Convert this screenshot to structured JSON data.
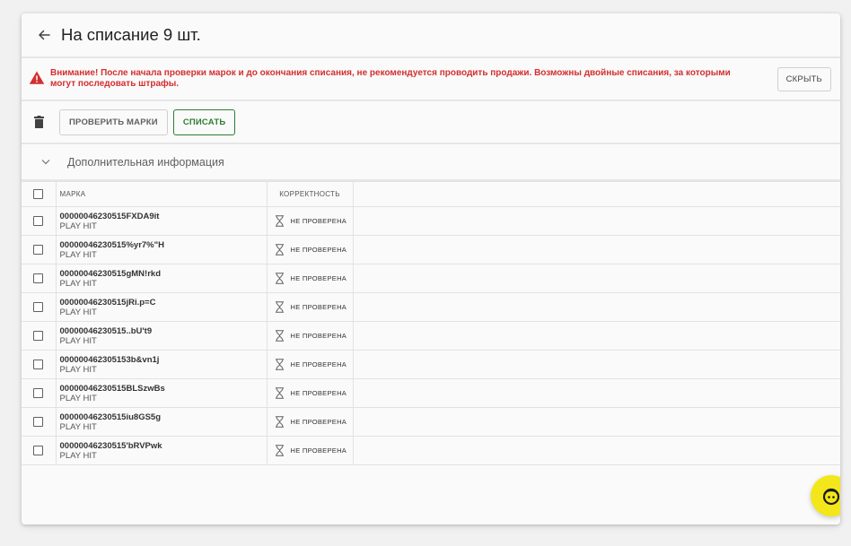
{
  "header": {
    "title": "На списание 9 шт."
  },
  "alert": {
    "text": "Внимание! После начала проверки марок и до окончания списания, не рекомендуется проводить продажи. Возможны двойные списания, за которыми могут последовать штрафы.",
    "hide_label": "СКРЫТЬ",
    "color": "#d32f2f"
  },
  "toolbar": {
    "check_label": "ПРОВЕРИТЬ МАРКИ",
    "write_off_label": "СПИСАТЬ",
    "write_off_color": "#2e7d32"
  },
  "more_info": {
    "label": "Дополнительная информация"
  },
  "table": {
    "columns": [
      "МАРКА",
      "КОРРЕКТНОСТЬ"
    ],
    "rows": [
      {
        "code": "00000046230515FXDA9it",
        "product": "PLAY HIT",
        "status": "НЕ ПРОВЕРЕНА"
      },
      {
        "code": "00000046230515%yr7%\"H",
        "product": "PLAY HIT",
        "status": "НЕ ПРОВЕРЕНА"
      },
      {
        "code": "00000046230515gMN!rkd",
        "product": "PLAY HIT",
        "status": "НЕ ПРОВЕРЕНА"
      },
      {
        "code": "00000046230515jRi.p=C",
        "product": "PLAY HIT",
        "status": "НЕ ПРОВЕРЕНА"
      },
      {
        "code": "00000046230515..bU't9",
        "product": "PLAY HIT",
        "status": "НЕ ПРОВЕРЕНА"
      },
      {
        "code": "000000462305153b&vn1j",
        "product": "PLAY HIT",
        "status": "НЕ ПРОВЕРЕНА"
      },
      {
        "code": "00000046230515BLSzwBs",
        "product": "PLAY HIT",
        "status": "НЕ ПРОВЕРЕНА"
      },
      {
        "code": "00000046230515iu8GS5g",
        "product": "PLAY HIT",
        "status": "НЕ ПРОВЕРЕНА"
      },
      {
        "code": "00000046230515'bRVPwk",
        "product": "PLAY HIT",
        "status": "НЕ ПРОВЕРЕНА"
      }
    ]
  },
  "icons": {
    "back": "arrow-left-icon",
    "alert": "warning-triangle-icon",
    "trash": "trash-icon",
    "chevron": "chevron-down-icon",
    "status": "hourglass-icon",
    "fab": "support-chat-icon"
  },
  "fab_color": "#f3e61a"
}
